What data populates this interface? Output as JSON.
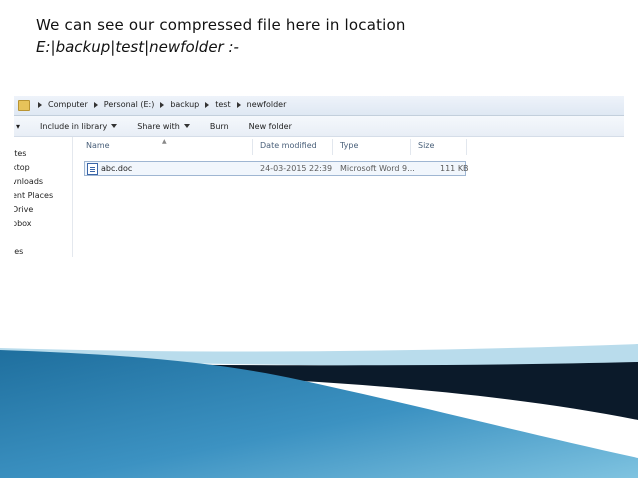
{
  "slide": {
    "line1": "We can see our compressed file here in location",
    "line2": "E:|backup|test|newfolder :-"
  },
  "explorer": {
    "breadcrumb": [
      "Computer",
      "Personal (E:)",
      "backup",
      "test",
      "newfolder"
    ],
    "toolbar": {
      "organize_arrow": "▾",
      "include_in_library": "Include in library",
      "share_with": "Share with",
      "burn": "Burn",
      "new_folder": "New folder"
    },
    "nav_items": [
      "ites",
      "ktop",
      "vnloads",
      "ent Places",
      "Drive",
      "pbox",
      "ies"
    ],
    "columns": {
      "name": "Name",
      "date_modified": "Date modified",
      "type": "Type",
      "size": "Size"
    },
    "files": [
      {
        "name": "abc.doc",
        "date_modified": "24-03-2015 22:39",
        "type": "Microsoft Word 9...",
        "size": "111 KB",
        "icon": "word-doc-icon"
      }
    ]
  },
  "colors": {
    "swoosh_dark": "#0b1a2a",
    "swoosh_blue": "#3c92c2",
    "swoosh_light": "#9fd0e8"
  }
}
